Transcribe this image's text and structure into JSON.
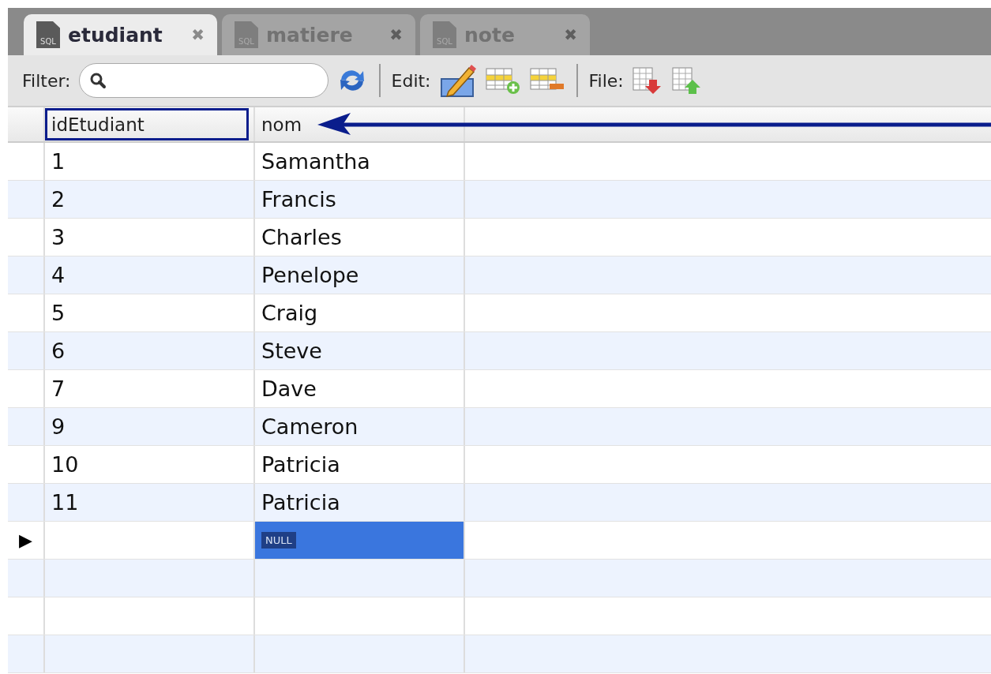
{
  "tabs": [
    {
      "icon_label": "SQL",
      "label": "etudiant",
      "close": "✖",
      "selected": true
    },
    {
      "icon_label": "SQL",
      "label": "matiere",
      "close": "✖",
      "selected": false
    },
    {
      "icon_label": "SQL",
      "label": "note",
      "close": "✖",
      "selected": false
    }
  ],
  "toolbar": {
    "filter_label": "Filter:",
    "edit_label": "Edit:",
    "file_label": "File:"
  },
  "table": {
    "columns": [
      {
        "name": "idEtudiant",
        "highlighted": true
      },
      {
        "name": "nom",
        "highlighted": false
      }
    ],
    "rows": [
      {
        "cells": [
          "1",
          "Samantha"
        ]
      },
      {
        "cells": [
          "2",
          "Francis"
        ]
      },
      {
        "cells": [
          "3",
          "Charles"
        ]
      },
      {
        "cells": [
          "4",
          "Penelope"
        ]
      },
      {
        "cells": [
          "5",
          "Craig"
        ]
      },
      {
        "cells": [
          "6",
          "Steve"
        ]
      },
      {
        "cells": [
          "7",
          "Dave"
        ]
      },
      {
        "cells": [
          "9",
          "Cameron"
        ]
      },
      {
        "cells": [
          "10",
          "Patricia"
        ]
      },
      {
        "cells": [
          "11",
          "Patricia"
        ]
      }
    ],
    "new_row": {
      "marker": "▶",
      "value": "NULL",
      "selected": true
    }
  }
}
